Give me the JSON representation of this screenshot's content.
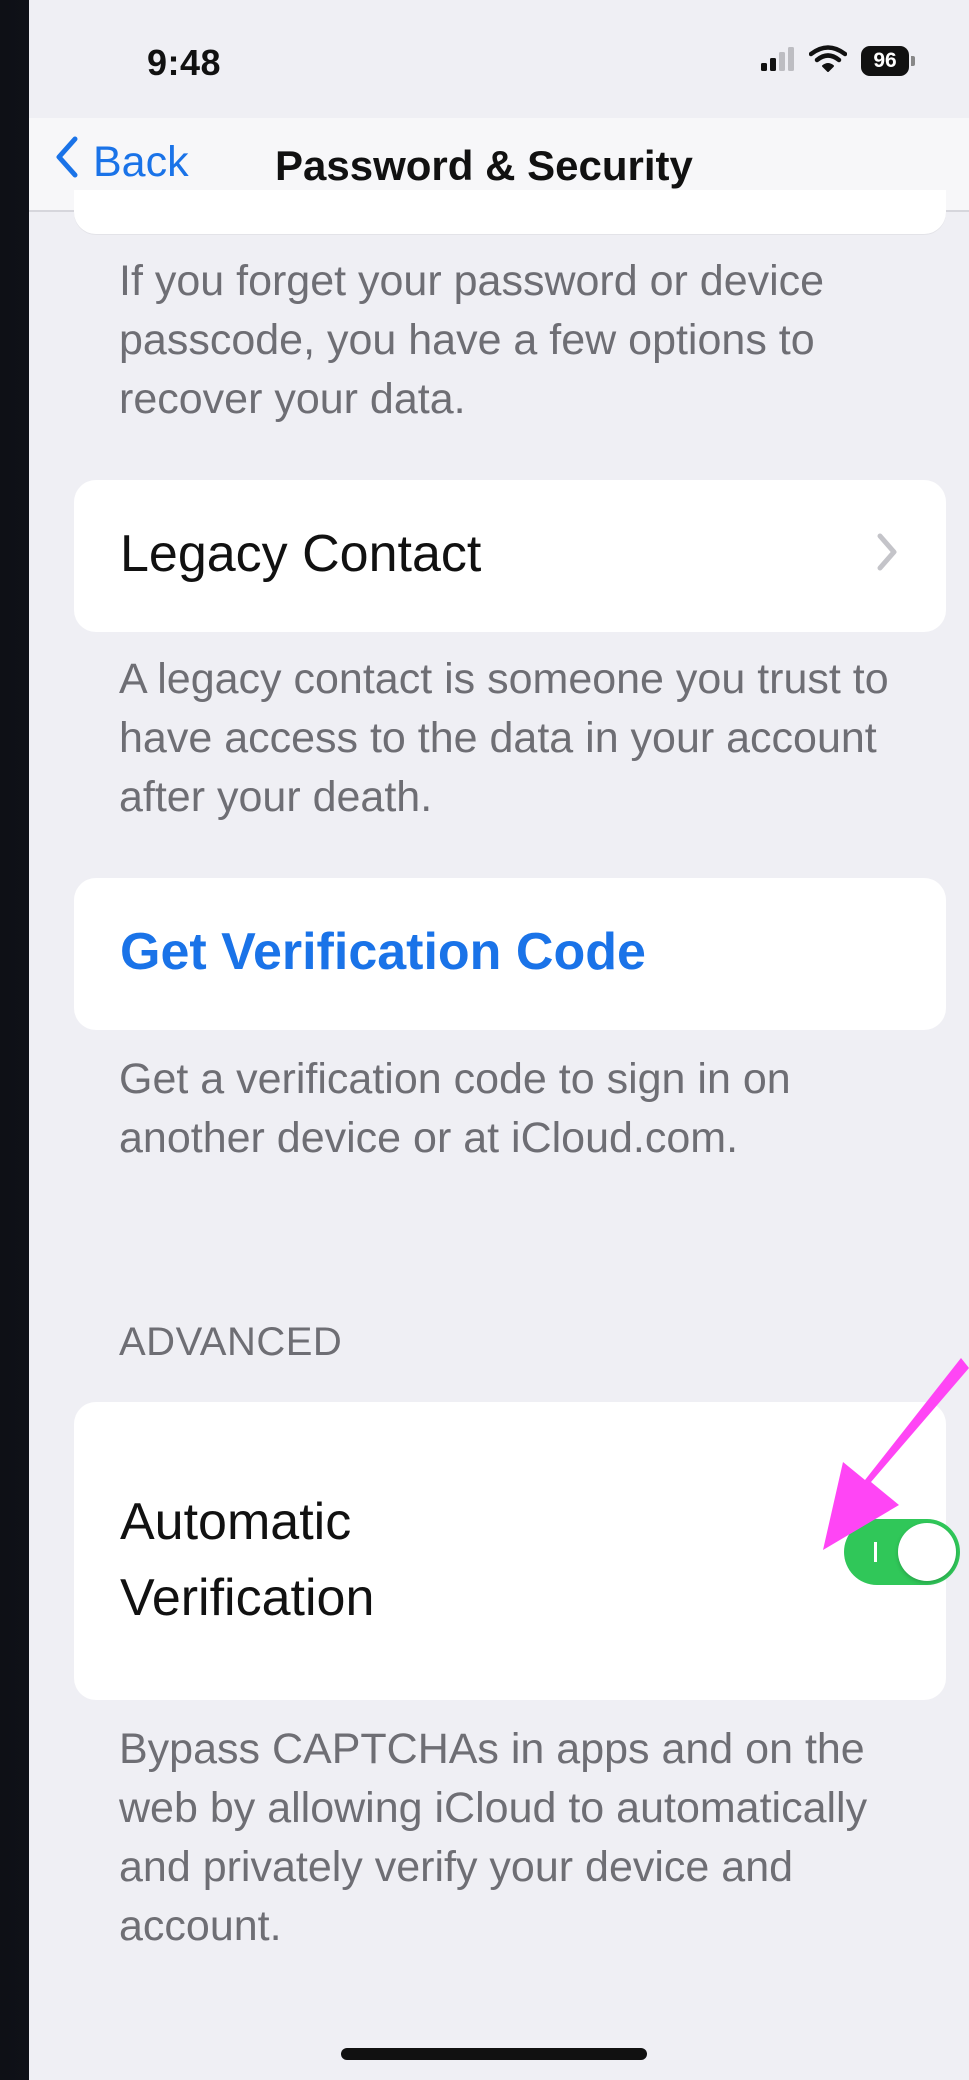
{
  "status_bar": {
    "time": "9:48",
    "battery_level": "96",
    "icons": [
      "cellular-signal-icon",
      "wifi-icon",
      "battery-icon"
    ]
  },
  "nav": {
    "back_label": "Back",
    "title": "Password & Security"
  },
  "recovery": {
    "footer": "If you forget your password or device passcode, you have a few options to recover your data."
  },
  "legacy_contact": {
    "label": "Legacy Contact",
    "footer": "A legacy contact is someone you trust to have access to the data in your account after your death."
  },
  "verification_code": {
    "label": "Get Verification Code",
    "footer": "Get a verification code to sign in on another device or at iCloud.com."
  },
  "advanced": {
    "header": "ADVANCED",
    "automatic_verification": {
      "label_line1": "Automatic",
      "label_line2": "Verification",
      "enabled": true
    },
    "footer": "Bypass CAPTCHAs in apps and on the web by allowing iCloud to automatically and privately verify your device and account."
  },
  "colors": {
    "accent_blue": "#1a73e8",
    "toggle_on": "#30c759",
    "annotation_arrow": "#ff45f5",
    "background": "#efeff4"
  }
}
